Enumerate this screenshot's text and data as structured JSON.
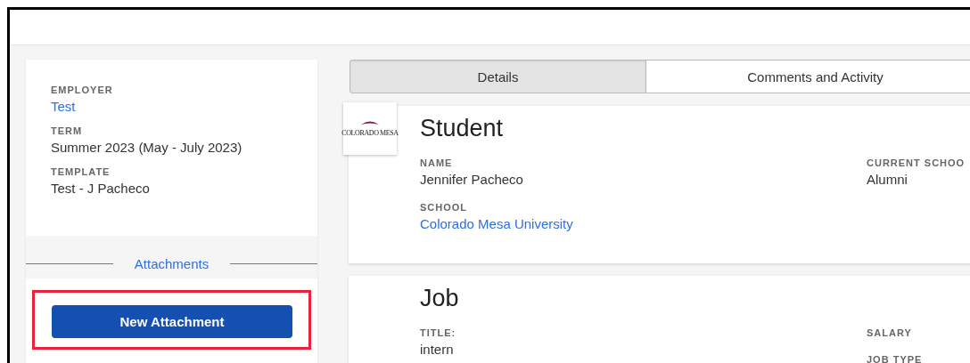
{
  "sidebar": {
    "fields": [
      {
        "label": "EMPLOYER",
        "value": "Test",
        "kind": "link"
      },
      {
        "label": "TERM",
        "value": "Summer 2023 (May - July 2023)",
        "kind": "text"
      },
      {
        "label": "TEMPLATE",
        "value": "Test - J Pacheco",
        "kind": "text"
      }
    ],
    "attachments_heading": "Attachments",
    "new_attachment_button": "New Attachment",
    "highlighted": true
  },
  "tabs": [
    {
      "label": "Details",
      "selected": true
    },
    {
      "label": "Comments and Activity",
      "selected": false
    }
  ],
  "sections": [
    {
      "title": "Student",
      "logo_text": "COLORADO MESA",
      "left_fields": [
        {
          "label": "NAME",
          "value": "Jennifer Pacheco",
          "kind": "text"
        },
        {
          "label": "SCHOOL",
          "value": "Colorado Mesa University",
          "kind": "link"
        }
      ],
      "right_fields": [
        {
          "label": "CURRENT SCHOO",
          "value": "Alumni",
          "kind": "text"
        }
      ]
    },
    {
      "title": "Job",
      "left_fields": [
        {
          "label": "TITLE:",
          "value": "intern",
          "kind": "text"
        }
      ],
      "right_fields": [
        {
          "label": "SALARY"
        },
        {
          "label": "JOB TYPE"
        }
      ]
    }
  ]
}
